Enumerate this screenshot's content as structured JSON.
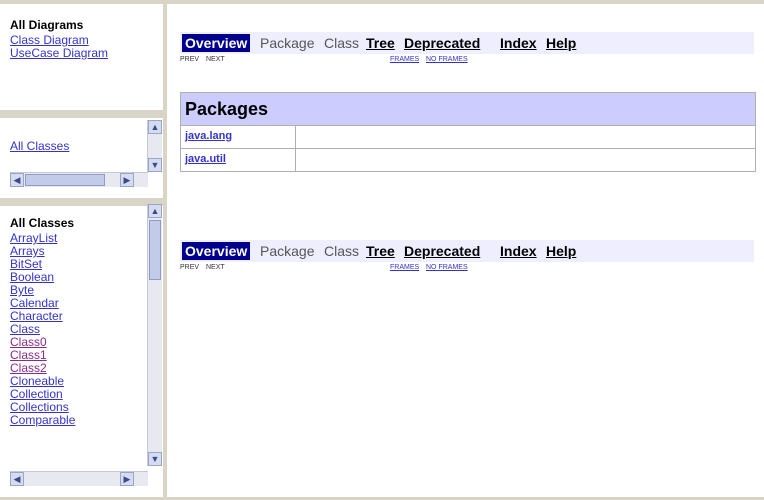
{
  "diagrams": {
    "title": "All Diagrams",
    "links": [
      "Class Diagram",
      "UseCase Diagram"
    ]
  },
  "all_classes_link": "All Classes",
  "class_list": {
    "title": "All Classes",
    "items": [
      "ArrayList",
      "Arrays",
      "BitSet",
      "Boolean",
      "Byte",
      "Calendar",
      "Character",
      "Class",
      "Class0",
      "Class1",
      "Class2",
      "Cloneable",
      "Collection",
      "Collections",
      "Comparable"
    ],
    "visited": [
      "Class0",
      "Class1",
      "Class2"
    ]
  },
  "navbar": {
    "overview": "Overview",
    "package": "Package",
    "class": "Class",
    "tree": "Tree",
    "deprecated": "Deprecated",
    "index": "Index",
    "help": "Help",
    "prev": "PREV",
    "next": "NEXT",
    "frames": "FRAMES",
    "no_frames": "NO FRAMES"
  },
  "packages": {
    "title": "Packages",
    "rows": [
      "java.lang",
      "java.util"
    ]
  },
  "colors": {
    "nav_bg": "#eeeeff",
    "nav_selected": "#00008b",
    "table_header": "#ccccff",
    "link": "#3333cc"
  }
}
